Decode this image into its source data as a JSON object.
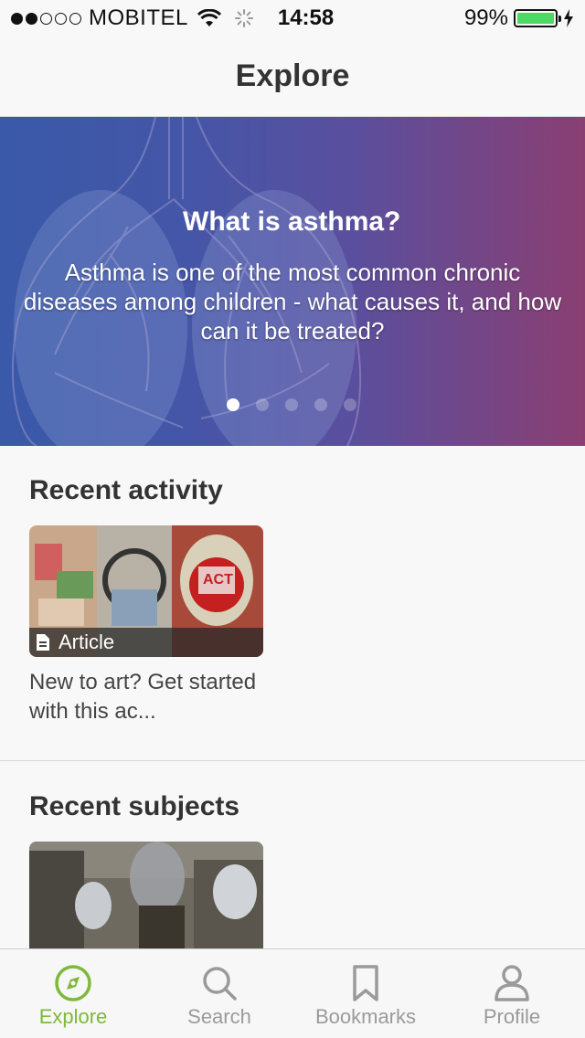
{
  "status_bar": {
    "carrier": "MOBITEL",
    "time": "14:58",
    "battery": "99%",
    "battery_level": 0.99
  },
  "nav": {
    "title": "Explore"
  },
  "hero": {
    "title": "What is asthma?",
    "description": "Asthma is one of the most common chronic diseases among children - what causes it, and how can it be treated?",
    "pages": 5,
    "active_page": 1
  },
  "recent_activity": {
    "title": "Recent activity",
    "card": {
      "badge": "Article",
      "caption": "New to art? Get started with this ac..."
    }
  },
  "recent_subjects": {
    "title": "Recent subjects"
  },
  "tabs": [
    {
      "label": "Explore",
      "icon": "compass-icon",
      "active": true
    },
    {
      "label": "Search",
      "icon": "search-icon",
      "active": false
    },
    {
      "label": "Bookmarks",
      "icon": "bookmark-icon",
      "active": false
    },
    {
      "label": "Profile",
      "icon": "person-icon",
      "active": false
    }
  ],
  "colors": {
    "accent": "#7fb83a",
    "inactive": "#9a9a9a"
  }
}
